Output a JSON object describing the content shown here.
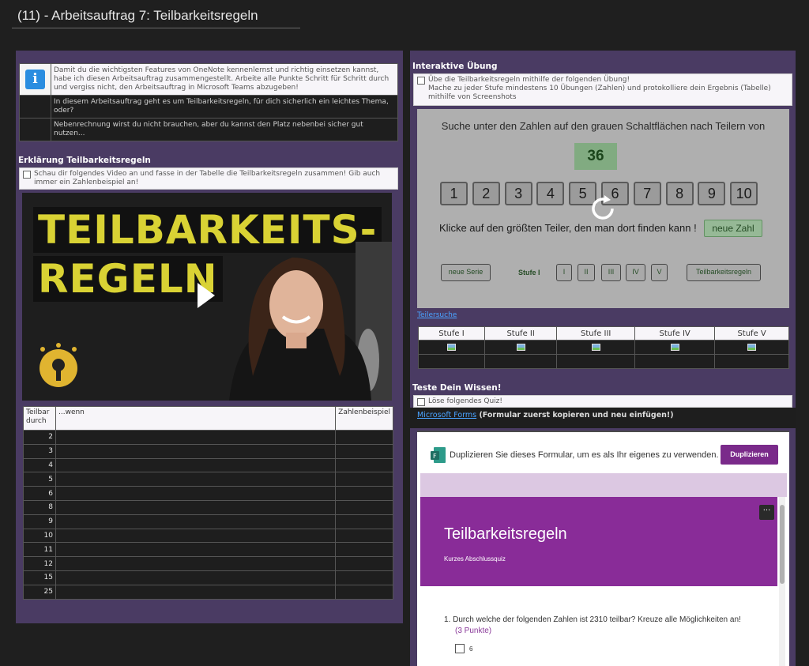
{
  "page": {
    "title": "(11) - Arbeitsauftrag 7: Teilbarkeitsregeln"
  },
  "info": {
    "rows": [
      "Damit du die wichtigsten Features von OneNote kennenlernst und richtig einsetzen kannst, habe ich diesen Arbeitsauftrag zusammengestellt. Arbeite alle Punkte Schritt für Schritt durch und vergiss nicht, den Arbeitsauftrag in Microsoft Teams abzugeben!",
      "In diesem Arbeitsauftrag geht es um Teilbarkeitsregeln, für dich sicherlich ein leichtes Thema, oder?",
      "Nebenrechnung wirst du nicht brauchen, aber du kannst den Platz nebenbei sicher gut nutzen..."
    ],
    "icon": "i"
  },
  "erklaerung": {
    "heading": "Erklärung Teilbarkeitsregeln",
    "task": "Schau dir folgendes Video an und fasse in der Tabelle die Teilbarkeitsregeln zusammen! Gib auch immer ein Zahlenbeispiel an!",
    "video_line1": "TEILBARKEITS-",
    "video_line2": "REGELN",
    "table": {
      "headers": [
        "Teilbar durch",
        "...wenn",
        "Zahlenbeispiel"
      ],
      "rows": [
        "2",
        "3",
        "4",
        "5",
        "6",
        "8",
        "9",
        "10",
        "11",
        "12",
        "15",
        "25"
      ]
    }
  },
  "uebung": {
    "heading": "Interaktive Übung",
    "task_line1": "Übe die Teilbarkeitsregeln mithilfe der folgenden Übung!",
    "task_line2": "Mache zu jeder Stufe mindestens 10 Übungen (Zahlen) und protokolliere dein Ergebnis (Tabelle) mithilfe von Screenshots",
    "game": {
      "question": "Suche unter den Zahlen auf den grauen Schaltflächen nach Teilern von",
      "number": "36",
      "buttons": [
        "1",
        "2",
        "3",
        "4",
        "5",
        "6",
        "7",
        "8",
        "9",
        "10"
      ],
      "hint": "Klicke auf den größten Teiler, den man dort finden kann !",
      "new_number": "neue Zahl",
      "new_series": "neue Serie",
      "level_label": "Stufe I",
      "levels": [
        "I",
        "II",
        "III",
        "IV",
        "V"
      ],
      "rules_button": "Teilbarkeitsregeln"
    },
    "link": "Teilersuche",
    "stufen": [
      "Stufe I",
      "Stufe II",
      "Stufe III",
      "Stufe IV",
      "Stufe V"
    ]
  },
  "quiz": {
    "heading": "Teste Dein Wissen!",
    "task": "Löse folgendes Quiz!",
    "link": "Microsoft Forms",
    "link_note": " (Formular zuerst kopieren und neu einfügen!)",
    "forms": {
      "duplicate_text": "Duplizieren Sie dieses Formular, um es als Ihr eigenes zu verwenden.",
      "duplicate_button": "Duplizieren",
      "title": "Teilbarkeitsregeln",
      "subtitle": "Kurzes Abschlussquiz",
      "more": "···",
      "question": "1. Durch welche der folgenden Zahlen ist 2310 teilbar? Kreuze alle Möglichkeiten an!",
      "points": "(3 Punkte)",
      "option1": "6"
    }
  },
  "colors": {
    "panel": "#4a3b63",
    "background": "#1f1f1f",
    "forms_purple": "#892c98",
    "accent_link": "#4aa3ff"
  }
}
